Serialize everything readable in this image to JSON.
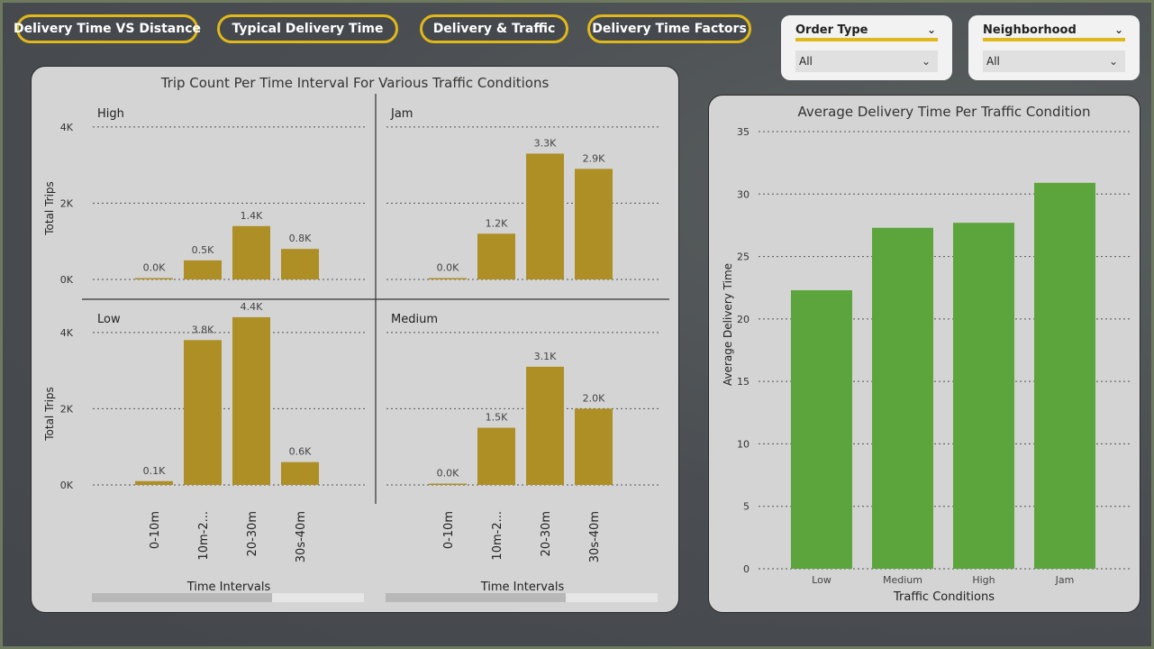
{
  "nav": [
    {
      "label": "Delivery Time VS Distance"
    },
    {
      "label": "Typical Delivery Time"
    },
    {
      "label": "Delivery & Traffic"
    },
    {
      "label": "Delivery Time Factors"
    }
  ],
  "slicers": [
    {
      "title": "Order Type",
      "value": "All"
    },
    {
      "title": "Neighborhood",
      "value": "All"
    }
  ],
  "colors": {
    "gold": "#ae8f25",
    "green": "#5ba53c",
    "accent": "#e0b81a"
  },
  "chart_data": [
    {
      "type": "bar",
      "title": "Trip Count Per Time Interval For Various Traffic Conditions",
      "xlabel": "Time Intervals",
      "ylabel": "Total Trips",
      "categories": [
        "0-10m",
        "10m-2...",
        "20-30m",
        "30s-40m"
      ],
      "yticks": [
        "0K",
        "2K",
        "4K"
      ],
      "ylim": [
        0,
        4800
      ],
      "grid": true,
      "panels": [
        {
          "name": "High",
          "values": [
            0,
            500,
            1400,
            800
          ],
          "labels": [
            "0.0K",
            "0.5K",
            "1.4K",
            "0.8K"
          ]
        },
        {
          "name": "Jam",
          "values": [
            0,
            1200,
            3300,
            2900
          ],
          "labels": [
            "0.0K",
            "1.2K",
            "3.3K",
            "2.9K"
          ]
        },
        {
          "name": "Low",
          "values": [
            100,
            3800,
            4400,
            600
          ],
          "labels": [
            "0.1K",
            "3.8K",
            "4.4K",
            "0.6K"
          ]
        },
        {
          "name": "Medium",
          "values": [
            0,
            1500,
            3100,
            2000
          ],
          "labels": [
            "0.0K",
            "1.5K",
            "3.1K",
            "2.0K"
          ]
        }
      ]
    },
    {
      "type": "bar",
      "title": "Average Delivery Time Per Traffic Condition",
      "xlabel": "Traffic Conditions",
      "ylabel": "Average Delivery Time",
      "categories": [
        "Low",
        "Medium",
        "High",
        "Jam"
      ],
      "values": [
        22.3,
        27.3,
        27.7,
        30.9
      ],
      "yticks": [
        "0",
        "5",
        "10",
        "15",
        "20",
        "25",
        "30",
        "35"
      ],
      "ylim": [
        0,
        35
      ],
      "grid": true
    }
  ]
}
